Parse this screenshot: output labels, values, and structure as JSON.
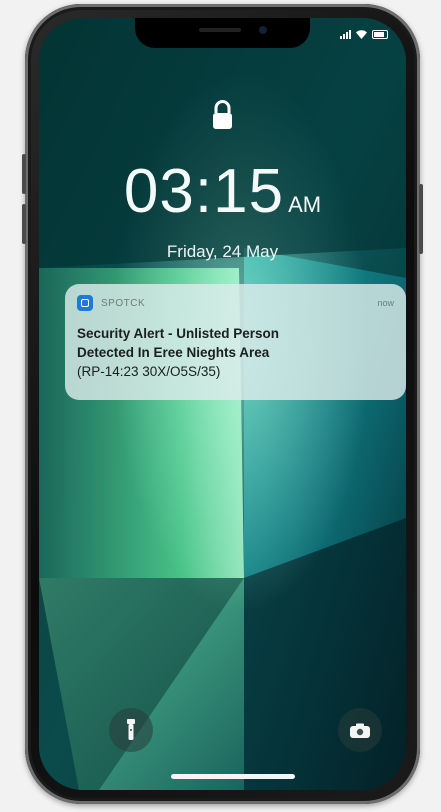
{
  "status_bar": {
    "icons": [
      "signal-icon",
      "wifi-icon",
      "battery-icon"
    ]
  },
  "lock_screen": {
    "lock_icon": "lock-icon",
    "time": "03:15",
    "ampm": "AM",
    "date": "Friday, 24 May"
  },
  "notification": {
    "app_icon": "camera-app-icon",
    "app_name": "SPOTCK",
    "time": "now",
    "line1": "Security Alert - Unlisted Person",
    "line2": "Detected In Eree Nieghts Area",
    "line3": "(RP-14:23 30X/O5S/35)"
  },
  "quick_actions": {
    "left": "flashlight-icon",
    "right": "camera-icon"
  },
  "colors": {
    "wallpaper_dark": "#04201f",
    "wallpaper_teal": "#0e6e72",
    "wallpaper_green": "#5fdc9a",
    "wallpaper_mint": "#9cf0c5"
  }
}
